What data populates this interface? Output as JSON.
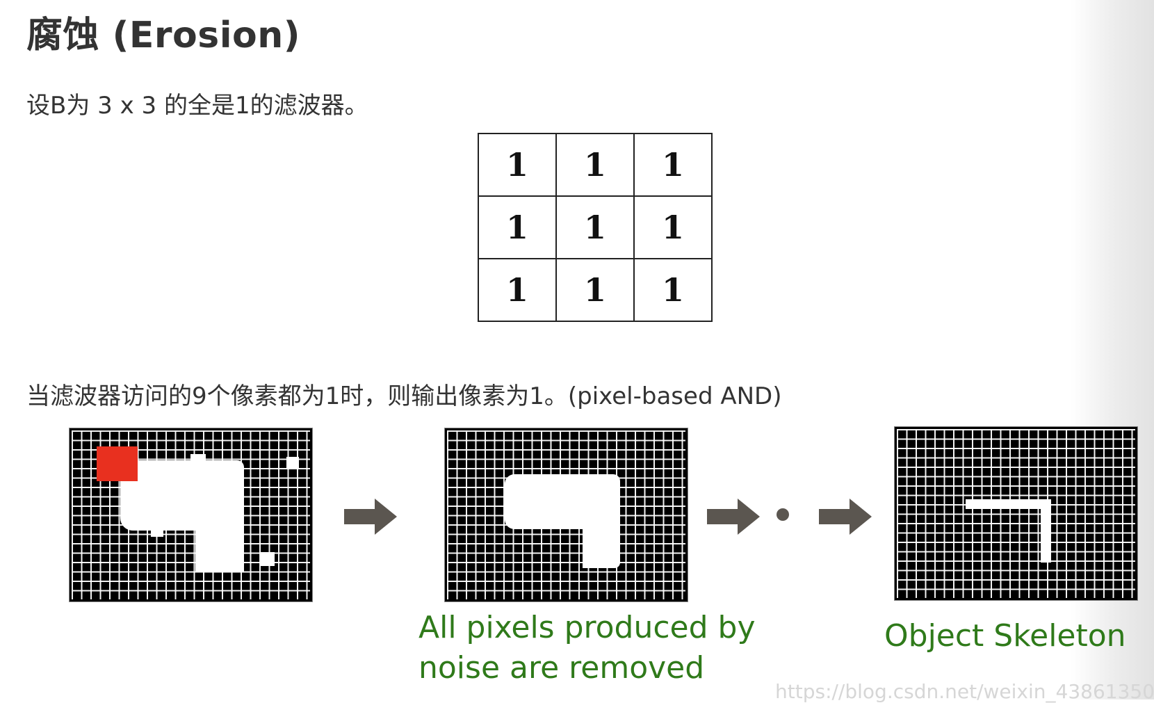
{
  "heading": "腐蚀 (Erosion)",
  "paragraph_1": "设B为 3 x 3 的全是1的滤波器。",
  "filter": {
    "rows": [
      [
        "1",
        "1",
        "1"
      ],
      [
        "1",
        "1",
        "1"
      ],
      [
        "1",
        "1",
        "1"
      ]
    ]
  },
  "paragraph_2": "当滤波器访问的9个像素都为1时，则输出像素为1。(pixel-based AND)",
  "figure": {
    "caption_noise_line1": "All pixels produced by",
    "caption_noise_line2": "noise are removed",
    "caption_skeleton": "Object Skeleton"
  },
  "colors": {
    "text": "#333333",
    "caption_green": "#2f7a1a",
    "arrow_gray": "#5b5650",
    "highlight_red": "#e8301f"
  },
  "icons": [
    "arrow-right-icon",
    "ellipsis-dot-icon"
  ],
  "watermark": "https://blog.csdn.net/weixin_43861350"
}
